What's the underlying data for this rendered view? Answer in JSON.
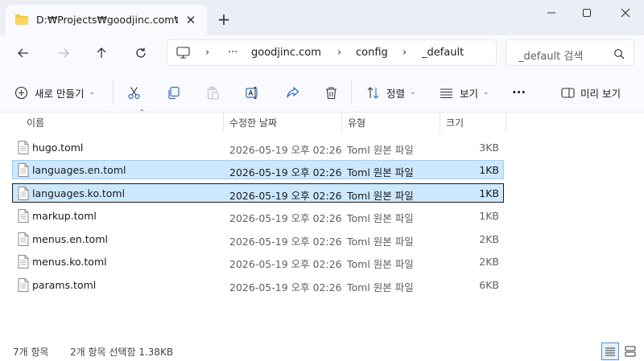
{
  "window": {
    "tab_title": "D:₩Projects₩goodjinc.com₩c",
    "close_tab": "✕",
    "new_tab": "+"
  },
  "address": {
    "overflow": "···",
    "crumbs": [
      "goodjinc.com",
      "config",
      "_default"
    ]
  },
  "search": {
    "placeholder": "_default 검색"
  },
  "toolbar": {
    "new_label": "새로 만들기",
    "sort_label": "정렬",
    "view_label": "보기",
    "more_label": "···",
    "preview_label": "미리 보기"
  },
  "columns": {
    "name": "이름",
    "modified": "수정한 날짜",
    "type": "유형",
    "size": "크기",
    "sort_indicator": "⌃"
  },
  "files": [
    {
      "name": "hugo.toml",
      "modified": "2026-05-19 오후 02:26",
      "type": "Toml 원본 파일",
      "size": "3KB"
    },
    {
      "name": "languages.en.toml",
      "modified": "2026-05-19 오후 02:26",
      "type": "Toml 원본 파일",
      "size": "1KB"
    },
    {
      "name": "languages.ko.toml",
      "modified": "2026-05-19 오후 02:26",
      "type": "Toml 원본 파일",
      "size": "1KB"
    },
    {
      "name": "markup.toml",
      "modified": "2026-05-19 오후 02:26",
      "type": "Toml 원본 파일",
      "size": "1KB"
    },
    {
      "name": "menus.en.toml",
      "modified": "2026-05-19 오후 02:26",
      "type": "Toml 원본 파일",
      "size": "2KB"
    },
    {
      "name": "menus.ko.toml",
      "modified": "2026-05-19 오후 02:26",
      "type": "Toml 원본 파일",
      "size": "2KB"
    },
    {
      "name": "params.toml",
      "modified": "2026-05-19 오후 02:26",
      "type": "Toml 원본 파일",
      "size": "6KB"
    }
  ],
  "status": {
    "item_count": "7개 항목",
    "selection": "2개 항목 선택함 1.38KB"
  },
  "colors": {
    "selection_fill": "#cce8ff",
    "selection_border": "#99d1ff",
    "folder_yellow": "#f2c744"
  },
  "icons": {
    "tab": "folder-icon",
    "nav": [
      "back-arrow-icon",
      "forward-arrow-icon",
      "up-arrow-icon",
      "refresh-icon"
    ],
    "toolbar": [
      "cut-icon",
      "copy-icon",
      "paste-icon",
      "rename-icon",
      "share-icon",
      "delete-icon"
    ]
  }
}
